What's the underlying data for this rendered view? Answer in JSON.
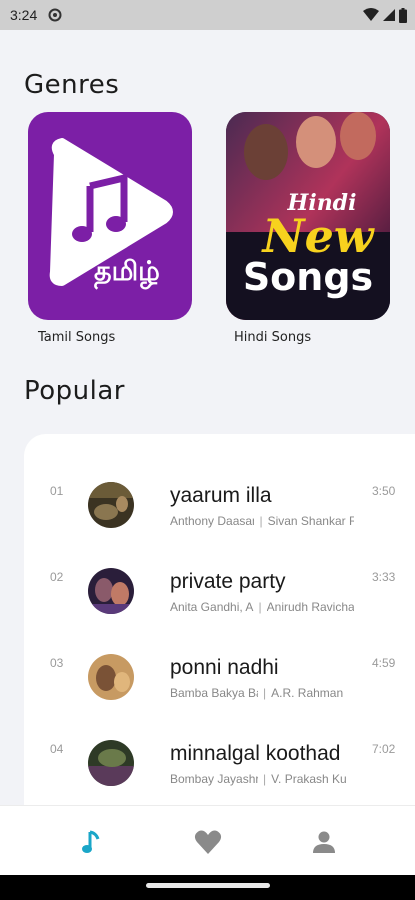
{
  "status_bar": {
    "time": "3:24"
  },
  "genres": {
    "title": "Genres",
    "items": [
      {
        "label": "Tamil Songs",
        "cover_text": "தமிழ்"
      },
      {
        "label": "Hindi Songs",
        "cover_text_1": "Hindi",
        "cover_text_2": "New",
        "cover_text_3": "Songs"
      }
    ]
  },
  "popular": {
    "title": "Popular",
    "tracks": [
      {
        "number": "01",
        "title": "yaarum illa",
        "artist_1": "Anthony Daasan",
        "artist_2": "Sivan Shankar R",
        "duration": "3:50"
      },
      {
        "number": "02",
        "title": "private party",
        "artist_1": "Anita Gandhi, A",
        "artist_2": "Anirudh Ravichar",
        "duration": "3:33"
      },
      {
        "number": "03",
        "title": "ponni nadhi",
        "artist_1": "Bamba Bakya Ba",
        "artist_2": "A.R. Rahman",
        "duration": "4:59"
      },
      {
        "number": "04",
        "title": "minnalgal koothad",
        "artist_1": "Bombay Jayashr",
        "artist_2": "V. Prakash Ku",
        "duration": "7:02"
      }
    ]
  },
  "bottom_nav": {
    "items": [
      "music-note-icon",
      "heart-icon",
      "person-icon"
    ],
    "active_color": "#1aa6c8",
    "inactive_color": "#8a8a8a"
  },
  "colors": {
    "tamil_cover": "#7c1fa6",
    "hindi_cover": "#2a1b3f",
    "background": "#f2f3f7"
  }
}
